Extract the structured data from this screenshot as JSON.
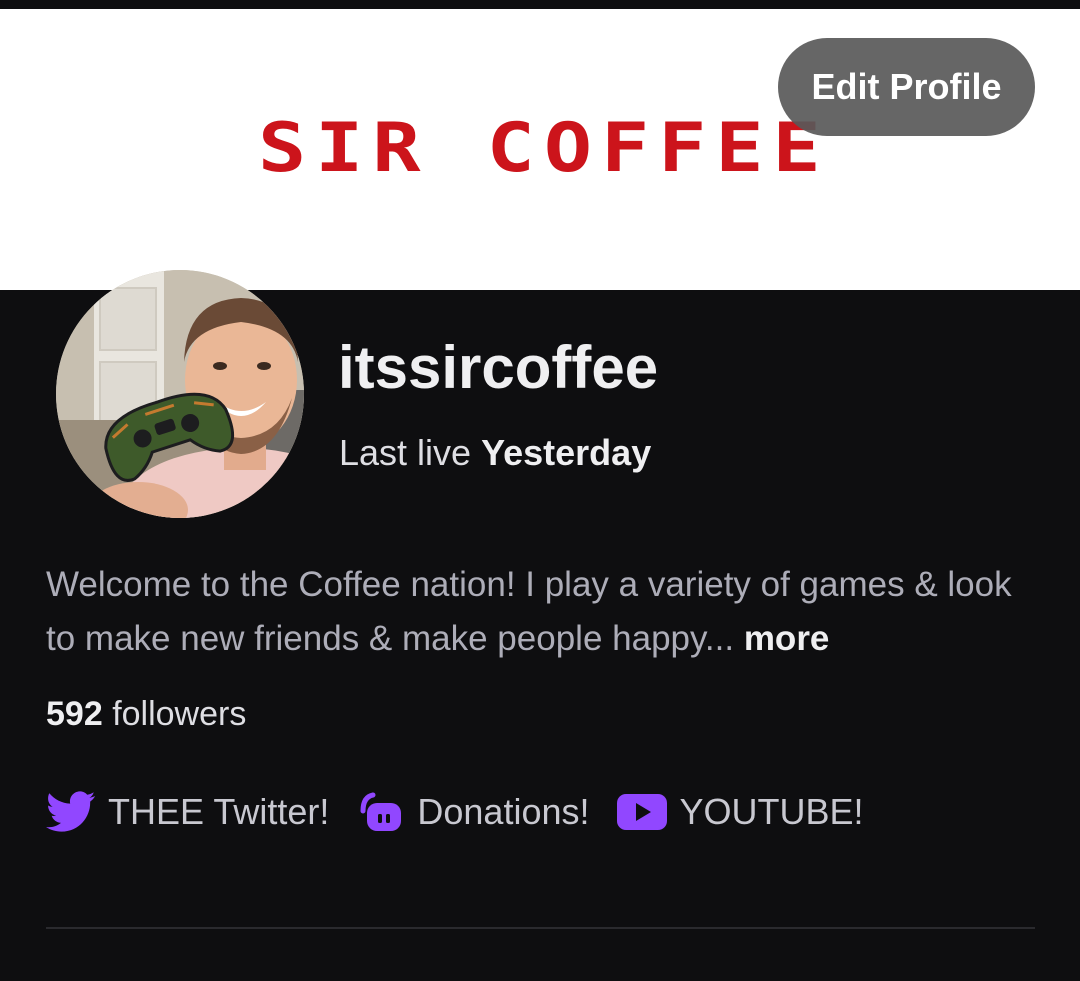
{
  "banner": {
    "title": "SIR COFFEE",
    "title_color": "#cc141b"
  },
  "edit_profile": {
    "label": "Edit Profile"
  },
  "profile": {
    "username": "itssircoffee",
    "last_live_label": "Last live",
    "last_live_value": "Yesterday",
    "bio": "Welcome to the Coffee nation! I play a variety of games & look to make new friends & make people happy...",
    "bio_more": "more",
    "followers_count": "592",
    "followers_label": "followers"
  },
  "links": [
    {
      "icon": "twitter-icon",
      "label": "THEE Twitter!"
    },
    {
      "icon": "streamlabs-icon",
      "label": "Donations!"
    },
    {
      "icon": "youtube-icon",
      "label": "YOUTUBE!"
    }
  ],
  "colors": {
    "accent": "#9147ff",
    "background": "#0e0e10"
  }
}
